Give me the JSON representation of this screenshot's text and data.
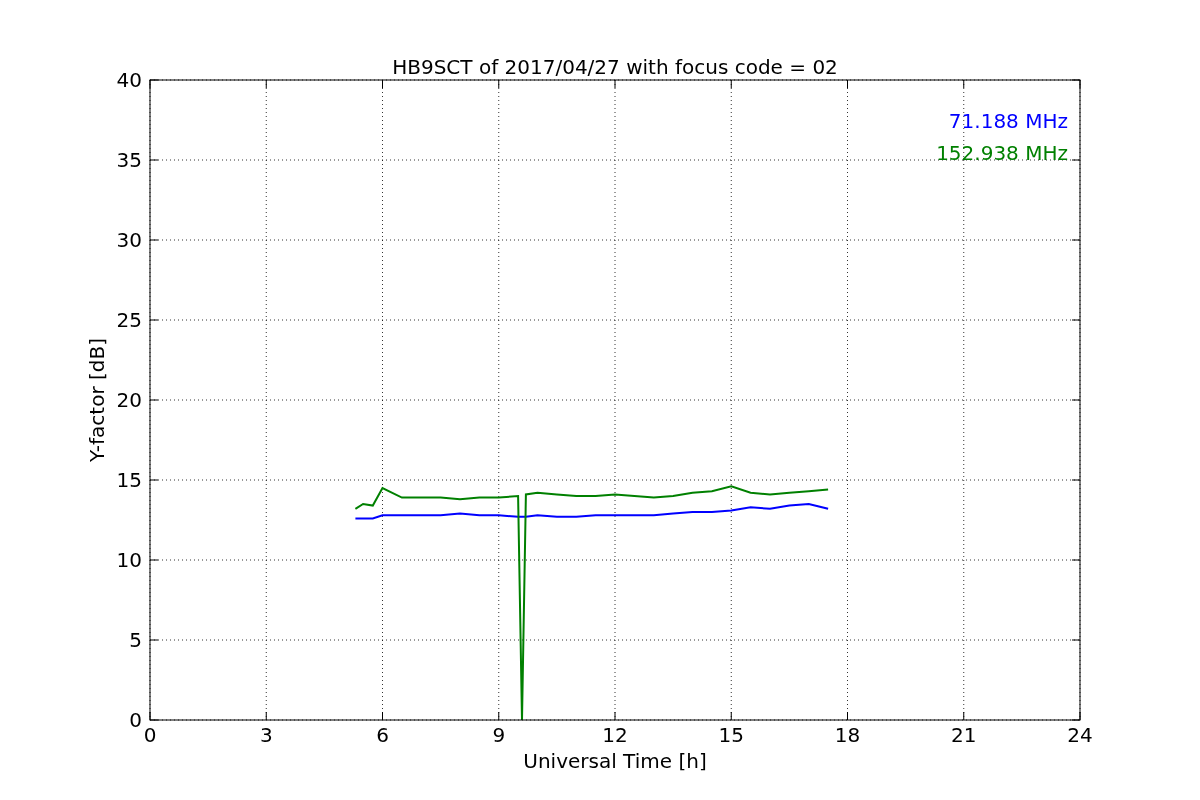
{
  "chart_data": {
    "type": "line",
    "title": "HB9SCT of 2017/04/27 with focus code = 02",
    "xlabel": "Universal Time [h]",
    "ylabel": "Y-factor [dB]",
    "x": [
      5.3,
      5.5,
      5.75,
      6,
      6.5,
      7,
      7.5,
      8,
      8.5,
      9,
      9.5,
      9.6,
      9.7,
      10,
      10.5,
      11,
      11.5,
      12,
      12.5,
      13,
      13.5,
      14,
      14.5,
      15,
      15.5,
      16,
      16.5,
      17,
      17.5
    ],
    "series": [
      {
        "name": "71.188 MHz",
        "color": "#0000ff",
        "values": [
          12.6,
          12.6,
          12.6,
          12.8,
          12.8,
          12.8,
          12.8,
          12.9,
          12.8,
          12.8,
          12.7,
          12.7,
          12.7,
          12.8,
          12.7,
          12.7,
          12.8,
          12.8,
          12.8,
          12.8,
          12.9,
          13.0,
          13.0,
          13.1,
          13.3,
          13.2,
          13.4,
          13.5,
          13.2
        ]
      },
      {
        "name": "152.938 MHz",
        "color": "#008000",
        "values": [
          13.2,
          13.5,
          13.4,
          14.5,
          13.9,
          13.9,
          13.9,
          13.8,
          13.9,
          13.9,
          14.0,
          0,
          14.1,
          14.2,
          14.1,
          14.0,
          14.0,
          14.1,
          14.0,
          13.9,
          14.0,
          14.2,
          14.3,
          14.6,
          14.2,
          14.1,
          14.2,
          14.3,
          14.4
        ]
      }
    ],
    "xlim": [
      0,
      24
    ],
    "ylim": [
      0,
      40
    ],
    "xticks": [
      0,
      3,
      6,
      9,
      12,
      15,
      18,
      21,
      24
    ],
    "yticks": [
      0,
      5,
      10,
      15,
      20,
      25,
      30,
      35,
      40
    ],
    "grid": true
  }
}
